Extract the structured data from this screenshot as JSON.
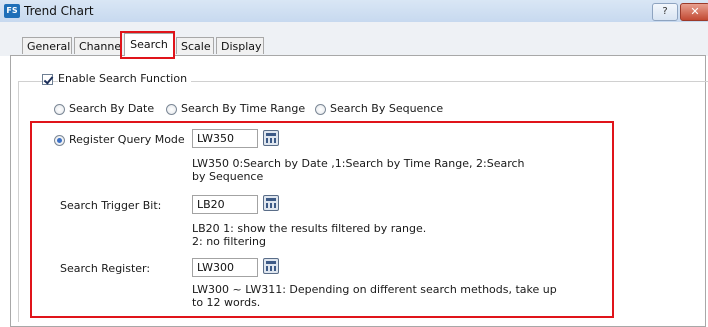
{
  "window": {
    "title": "Trend Chart",
    "app_icon_text": "FS",
    "help_label": "?",
    "close_label": "✕"
  },
  "tabs": [
    {
      "label": "General"
    },
    {
      "label": "Channe"
    },
    {
      "label": "Search"
    },
    {
      "label": "Scale"
    },
    {
      "label": "Display"
    }
  ],
  "active_tab": "Search",
  "enable_search": {
    "label": "Enable Search Function",
    "checked": true
  },
  "search_modes": [
    {
      "label": "Search By Date",
      "selected": false
    },
    {
      "label": "Search By Time Range",
      "selected": false
    },
    {
      "label": "Search By Sequence",
      "selected": false
    }
  ],
  "register_query": {
    "label": "Register Query Mode",
    "selected": true,
    "value": "LW350",
    "desc_line1": "LW350 0:Search by Date ,1:Search by Time Range, 2:Search",
    "desc_line2": "by Sequence"
  },
  "trigger_bit": {
    "label": "Search Trigger Bit:",
    "value": "LB20",
    "desc_line1": "LB20 1: show the results filtered by range.",
    "desc_line2": "2: no filtering"
  },
  "search_register": {
    "label": "Search Register:",
    "value": "LW300",
    "desc_line1": "LW300 ~ LW311: Depending on different search methods, take up",
    "desc_line2": "to 12 words."
  },
  "colors": {
    "highlight": "#e0141a",
    "titlebar": "#d9e6f5",
    "radio_dot": "#3b6fc4"
  }
}
